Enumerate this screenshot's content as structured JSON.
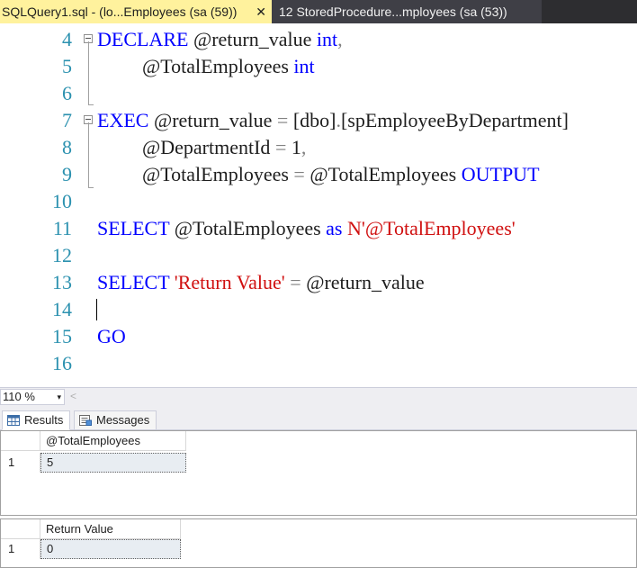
{
  "tabs": [
    {
      "label": "SQLQuery1.sql - (lo...Employees (sa (59))",
      "close": "✕"
    },
    {
      "label": "12 StoredProcedure...mployees (sa (53))"
    }
  ],
  "editor": {
    "lines": [
      {
        "num": "4"
      },
      {
        "num": "5"
      },
      {
        "num": "6"
      },
      {
        "num": "7"
      },
      {
        "num": "8"
      },
      {
        "num": "9"
      },
      {
        "num": "10"
      },
      {
        "num": "11"
      },
      {
        "num": "12"
      },
      {
        "num": "13"
      },
      {
        "num": "14"
      },
      {
        "num": "15"
      },
      {
        "num": "16"
      }
    ],
    "code": {
      "l4_kw": "DECLARE",
      "l4_var": " @return_value ",
      "l4_type": "int",
      "l4_comma": ",",
      "l5_var": "@TotalEmployees ",
      "l5_type": "int",
      "l7_kw": "EXEC",
      "l7_var": " @return_value ",
      "l7_eq": "=",
      "l7_obj": " [dbo]",
      "l7_dot": ".",
      "l7_proc": "[spEmployeeByDepartment]",
      "l8_var": "@DepartmentId ",
      "l8_eq": "=",
      "l8_val": " 1",
      "l8_comma": ",",
      "l9_var": "@TotalEmployees ",
      "l9_eq": "=",
      "l9_var2": " @TotalEmployees ",
      "l9_kw": "OUTPUT",
      "l11_kw": "SELECT",
      "l11_var": " @TotalEmployees ",
      "l11_as": "as",
      "l11_str": " N'@TotalEmployees'",
      "l13_kw": "SELECT",
      "l13_str": " 'Return Value'",
      "l13_eq": " =",
      "l13_var": " @return_value",
      "l15_kw": "GO"
    }
  },
  "zoom": {
    "value": "110 %",
    "arrow": "▾",
    "scroll_left": "<"
  },
  "results_tabs": [
    {
      "label": "Results"
    },
    {
      "label": "Messages"
    }
  ],
  "grid1": {
    "column": "@TotalEmployees",
    "row_num": "1",
    "value": "5"
  },
  "grid2": {
    "column": "Return Value",
    "row_num": "1",
    "value": "0"
  },
  "colors": {
    "keyword": "#0000ff",
    "string": "#d01010",
    "line_number": "#2b91af",
    "active_tab": "#fff29d"
  }
}
